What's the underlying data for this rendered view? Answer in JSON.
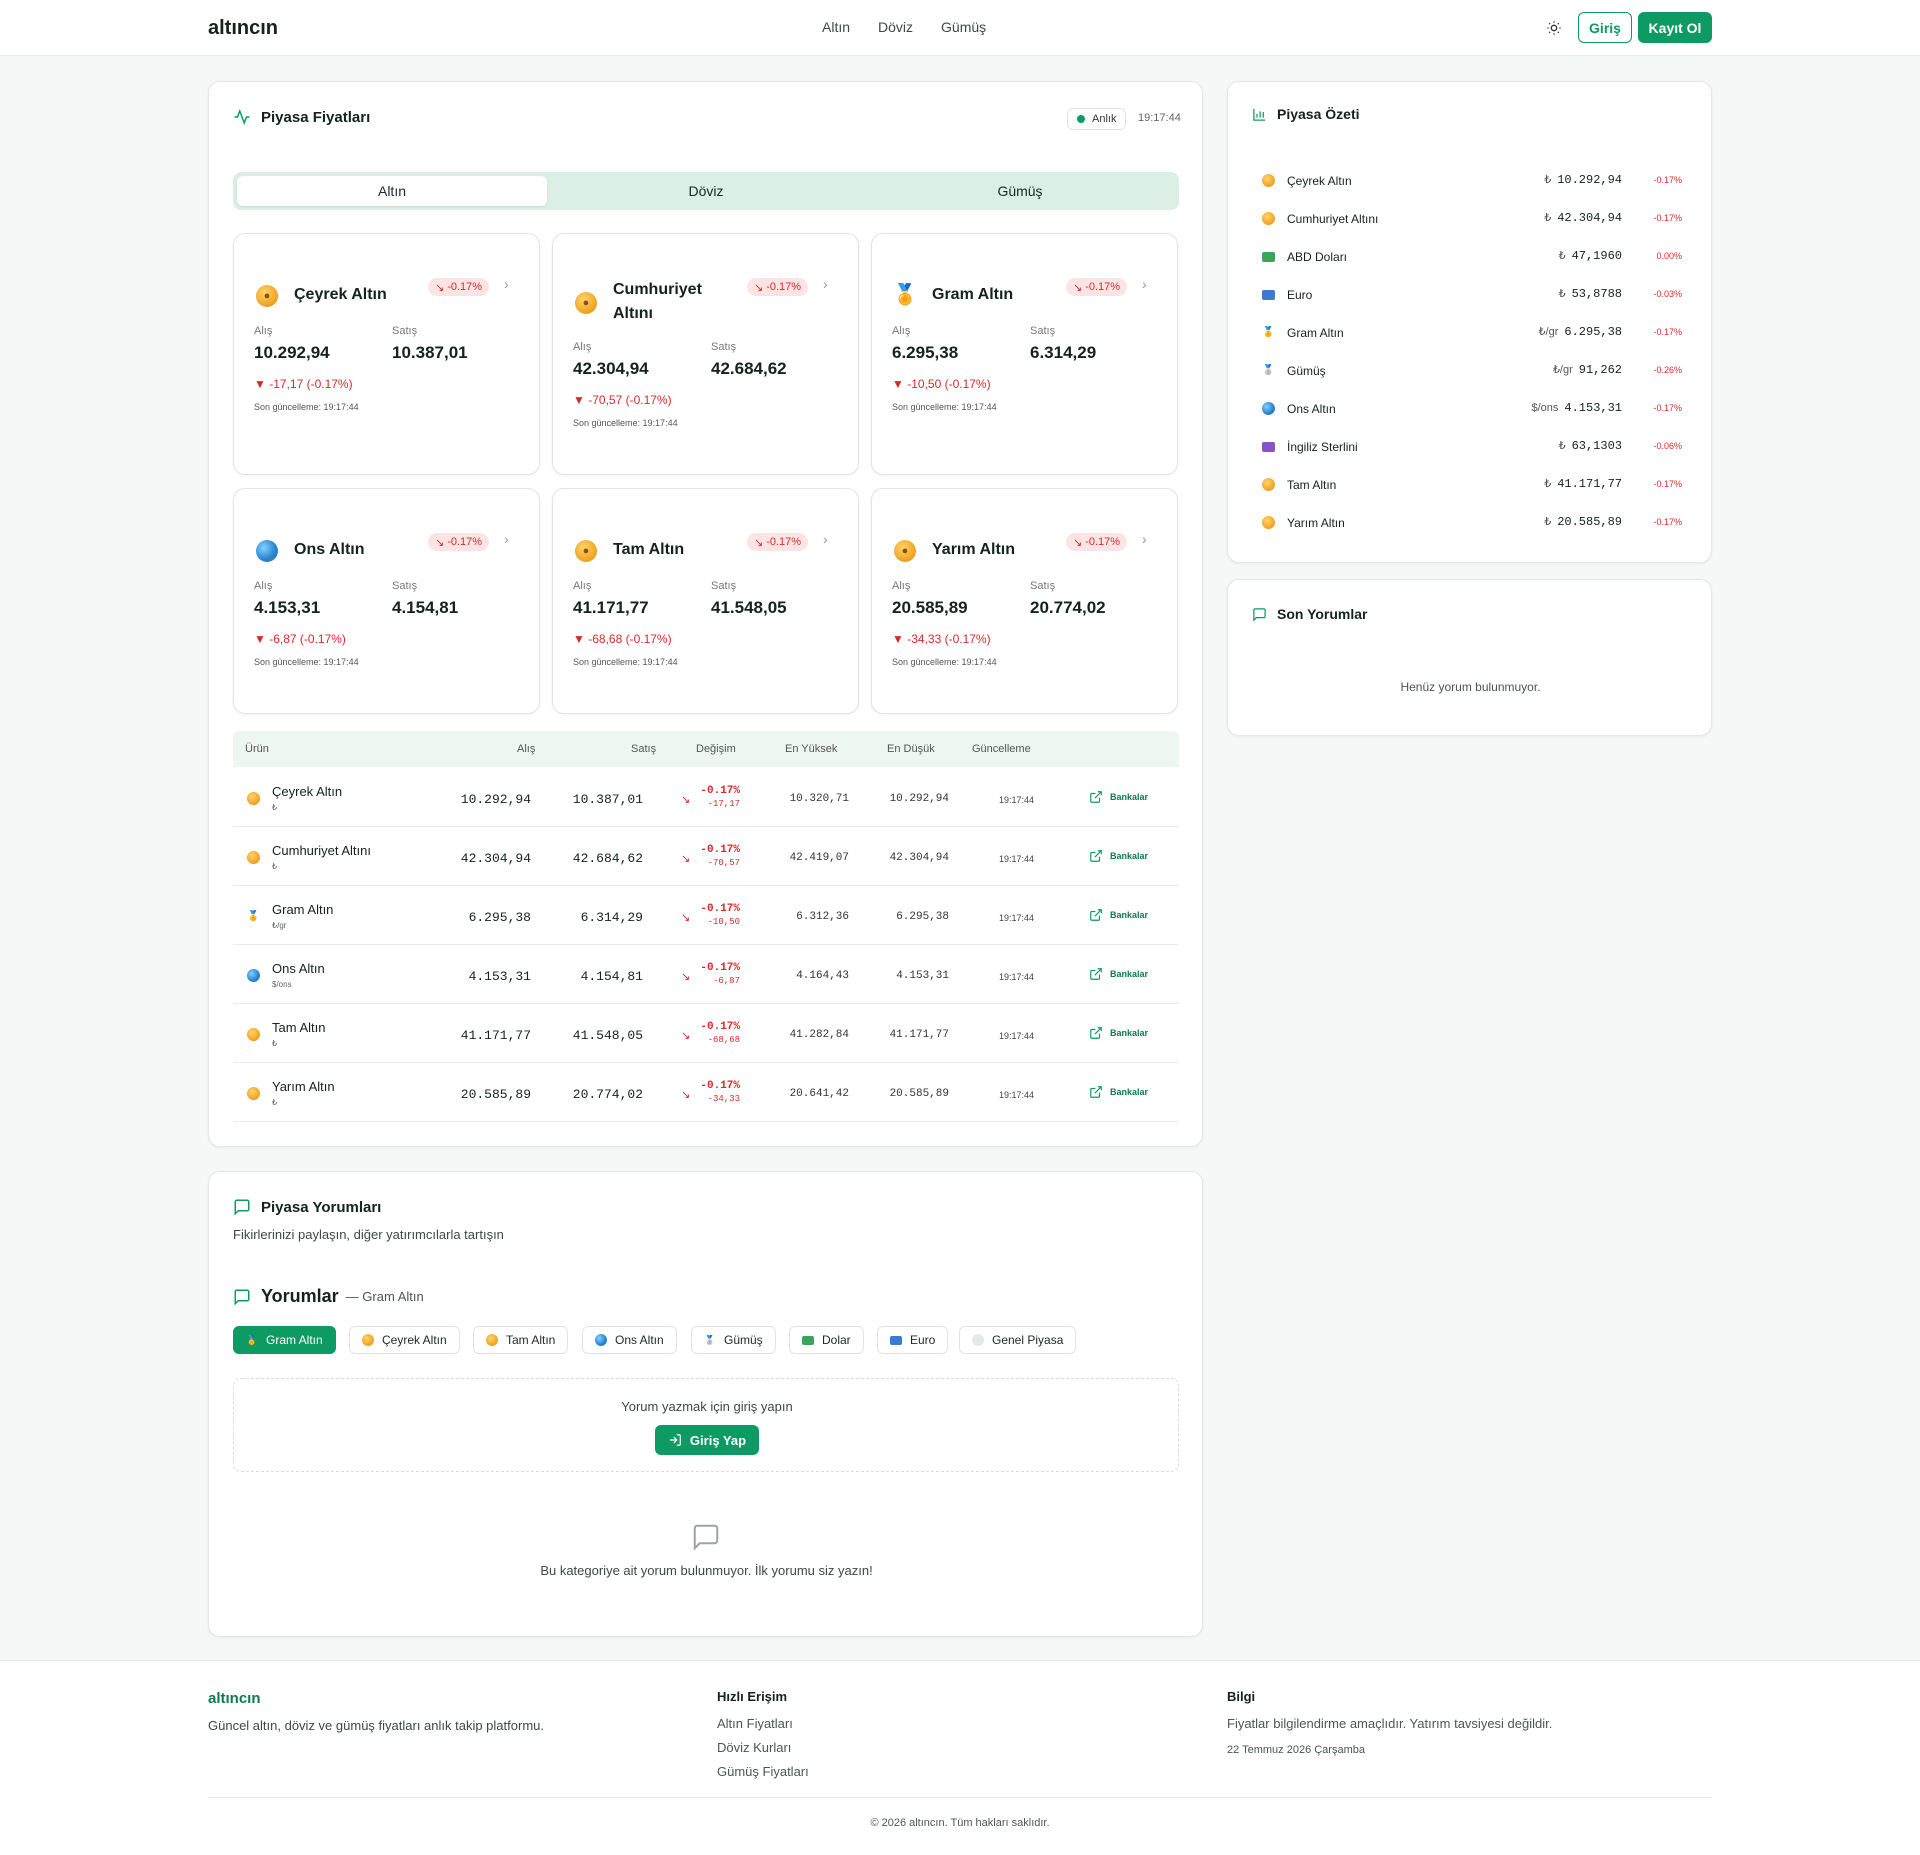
{
  "header": {
    "logo": "altıncın",
    "nav": [
      "Altın",
      "Döviz",
      "Gümüş"
    ],
    "login": "Giriş",
    "register": "Kayıt Ol"
  },
  "market": {
    "title": "Piyasa Fiyatları",
    "live": "Anlık",
    "time": "19:17:44",
    "tabs": [
      "Altın",
      "Döviz",
      "Gümüş"
    ],
    "buy_label": "Alış",
    "sell_label": "Satış",
    "updated_label": "Son güncelleme: 19:17:44",
    "cards": [
      {
        "name": "Çeyrek Altın",
        "badge": "-0.17%",
        "buy": "10.292,94",
        "sell": "10.387,01",
        "change": "-17,17 (-0.17%)"
      },
      {
        "name": "Cumhuriyet Altını",
        "badge": "-0.17%",
        "buy": "42.304,94",
        "sell": "42.684,62",
        "change": "-70,57 (-0.17%)"
      },
      {
        "name": "Gram Altın",
        "badge": "-0.17%",
        "buy": "6.295,38",
        "sell": "6.314,29",
        "change": "-10,50 (-0.17%)"
      },
      {
        "name": "Ons Altın",
        "badge": "-0.17%",
        "buy": "4.153,31",
        "sell": "4.154,81",
        "change": "-6,87 (-0.17%)"
      },
      {
        "name": "Tam Altın",
        "badge": "-0.17%",
        "buy": "41.171,77",
        "sell": "41.548,05",
        "change": "-68,68 (-0.17%)"
      },
      {
        "name": "Yarım Altın",
        "badge": "-0.17%",
        "buy": "20.585,89",
        "sell": "20.774,02",
        "change": "-34,33 (-0.17%)"
      }
    ],
    "table_headers": [
      "Ürün",
      "Alış",
      "Satış",
      "Değişim",
      "En Yüksek",
      "En Düşük",
      "Güncelleme"
    ],
    "rows": [
      {
        "name": "Çeyrek Altın",
        "unit": "₺",
        "buy": "10.292,94",
        "sell": "10.387,01",
        "pct": "-0.17%",
        "diff": "-17,17",
        "high": "10.320,71",
        "low": "10.292,94",
        "time": "19:17:44",
        "link": "Bankalar"
      },
      {
        "name": "Cumhuriyet Altını",
        "unit": "₺",
        "buy": "42.304,94",
        "sell": "42.684,62",
        "pct": "-0.17%",
        "diff": "-70,57",
        "high": "42.419,07",
        "low": "42.304,94",
        "time": "19:17:44",
        "link": "Bankalar"
      },
      {
        "name": "Gram Altın",
        "unit": "₺/gr",
        "buy": "6.295,38",
        "sell": "6.314,29",
        "pct": "-0.17%",
        "diff": "-10,50",
        "high": "6.312,36",
        "low": "6.295,38",
        "time": "19:17:44",
        "link": "Bankalar"
      },
      {
        "name": "Ons Altın",
        "unit": "$/ons",
        "buy": "4.153,31",
        "sell": "4.154,81",
        "pct": "-0.17%",
        "diff": "-6,87",
        "high": "4.164,43",
        "low": "4.153,31",
        "time": "19:17:44",
        "link": "Bankalar"
      },
      {
        "name": "Tam Altın",
        "unit": "₺",
        "buy": "41.171,77",
        "sell": "41.548,05",
        "pct": "-0.17%",
        "diff": "-68,68",
        "high": "41.282,84",
        "low": "41.171,77",
        "time": "19:17:44",
        "link": "Bankalar"
      },
      {
        "name": "Yarım Altın",
        "unit": "₺",
        "buy": "20.585,89",
        "sell": "20.774,02",
        "pct": "-0.17%",
        "diff": "-34,33",
        "high": "20.641,42",
        "low": "20.585,89",
        "time": "19:17:44",
        "link": "Bankalar"
      }
    ]
  },
  "summary": {
    "title": "Piyasa Özeti",
    "items": [
      {
        "name": "Çeyrek Altın",
        "cur": "₺",
        "val": "10.292,94",
        "chg": "-0.17%"
      },
      {
        "name": "Cumhuriyet Altını",
        "cur": "₺",
        "val": "42.304,94",
        "chg": "-0.17%"
      },
      {
        "name": "ABD Doları",
        "cur": "₺",
        "val": "47,1960",
        "chg": "0.00%"
      },
      {
        "name": "Euro",
        "cur": "₺",
        "val": "53,8788",
        "chg": "-0.03%"
      },
      {
        "name": "Gram Altın",
        "cur": "₺/gr",
        "val": "6.295,38",
        "chg": "-0.17%"
      },
      {
        "name": "Gümüş",
        "cur": "₺/gr",
        "val": "91,262",
        "chg": "-0.26%"
      },
      {
        "name": "Ons Altın",
        "cur": "$/ons",
        "val": "4.153,31",
        "chg": "-0.17%"
      },
      {
        "name": "İngiliz Sterlini",
        "cur": "₺",
        "val": "63,1303",
        "chg": "-0.06%"
      },
      {
        "name": "Tam Altın",
        "cur": "₺",
        "val": "41.171,77",
        "chg": "-0.17%"
      },
      {
        "name": "Yarım Altın",
        "cur": "₺",
        "val": "20.585,89",
        "chg": "-0.17%"
      }
    ]
  },
  "recent": {
    "title": "Son Yorumlar",
    "empty": "Henüz yorum bulunmuyor."
  },
  "comments": {
    "title": "Piyasa Yorumları",
    "subtitle": "Fikirlerinizi paylaşın, diğer yatırımcılarla tartışın",
    "section": "Yorumlar",
    "section_sub": "— Gram Altın",
    "tabs": [
      "Gram Altın",
      "Çeyrek Altın",
      "Tam Altın",
      "Ons Altın",
      "Gümüş",
      "Dolar",
      "Euro",
      "Genel Piyasa"
    ],
    "login_msg": "Yorum yazmak için giriş yapın",
    "login_btn": "Giriş Yap",
    "empty": "Bu kategoriye ait yorum bulunmuyor. İlk yorumu siz yazın!"
  },
  "footer": {
    "logo": "altıncın",
    "desc": "Güncel altın, döviz ve gümüş fiyatları anlık takip platformu.",
    "quick_title": "Hızlı Erişim",
    "links": [
      "Altın Fiyatları",
      "Döviz Kurları",
      "Gümüş Fiyatları"
    ],
    "info_title": "Bilgi",
    "info": "Fiyatlar bilgilendirme amaçlıdır. Yatırım tavsiyesi değildir.",
    "date": "22 Temmuz 2026 Çarşamba",
    "copyright": "© 2026 altıncın. Tüm hakları saklıdır."
  },
  "colors": {
    "brand": "#0d9a63",
    "negative": "#d62a2a"
  }
}
